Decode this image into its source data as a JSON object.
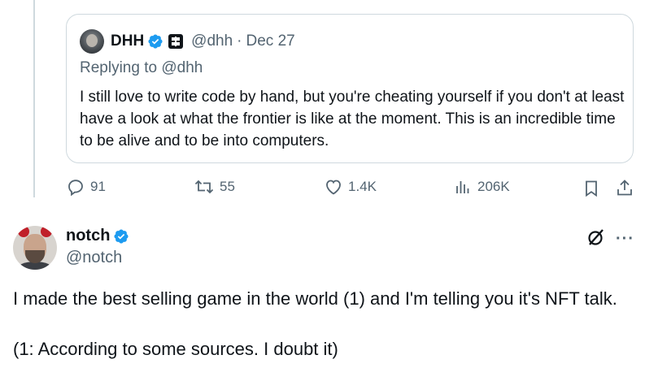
{
  "quoted_tweet": {
    "author_name": "DHH",
    "author_handle": "@dhh",
    "date_separator": "·",
    "date": "Dec 27",
    "replying_to": "Replying to @dhh",
    "text": "I still love to write code by hand, but you're cheating yourself if you don't at least have a look at what the frontier is like at the moment. This is an incredible time to be alive and to be into computers."
  },
  "actions": {
    "replies": "91",
    "reposts": "55",
    "likes": "1.4K",
    "views": "206K"
  },
  "tweet": {
    "author_name": "notch",
    "author_handle": "@notch",
    "more_label": "···",
    "text_line1": "I made the best selling game in the world (1) and I'm telling you it's NFT talk.",
    "text_line2": "(1: According to some sources. I doubt it)"
  },
  "colors": {
    "verified_blue": "#1d9bf0",
    "secondary_text": "#536471",
    "border": "#cfd9de",
    "primary_text": "#0f1419"
  },
  "icons": {
    "reply": "reply-icon",
    "repost": "repost-icon",
    "like": "heart-icon",
    "views": "views-icon",
    "bookmark": "bookmark-icon",
    "share": "share-icon",
    "grok": "grok-icon",
    "more": "more-icon",
    "verified": "verified-badge-icon"
  }
}
